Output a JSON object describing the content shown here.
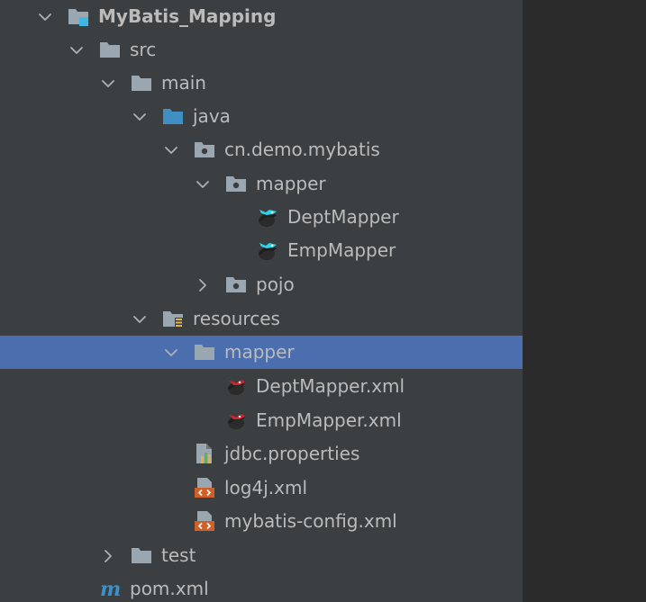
{
  "project_tree": {
    "project": {
      "label": "MyBatis_Mapping",
      "icon": "module-folder-icon",
      "expanded": true
    },
    "src": {
      "label": "src",
      "icon": "folder-icon",
      "expanded": true
    },
    "main": {
      "label": "main",
      "icon": "folder-icon",
      "expanded": true
    },
    "java": {
      "label": "java",
      "icon": "source-root-folder-icon",
      "expanded": true
    },
    "package": {
      "label": "cn.demo.mybatis",
      "icon": "package-icon",
      "expanded": true
    },
    "mapper_pkg": {
      "label": "mapper",
      "icon": "package-icon",
      "expanded": true
    },
    "dept_mapper": {
      "label": "DeptMapper",
      "icon": "mybatis-bird-icon"
    },
    "emp_mapper": {
      "label": "EmpMapper",
      "icon": "mybatis-bird-icon"
    },
    "pojo_pkg": {
      "label": "pojo",
      "icon": "package-icon",
      "expanded": false
    },
    "resources": {
      "label": "resources",
      "icon": "resources-root-folder-icon",
      "expanded": true
    },
    "mapper_dir": {
      "label": "mapper",
      "icon": "folder-icon",
      "expanded": true,
      "selected": true
    },
    "dept_mapper_xml": {
      "label": "DeptMapper.xml",
      "icon": "mybatis-xml-icon"
    },
    "emp_mapper_xml": {
      "label": "EmpMapper.xml",
      "icon": "mybatis-xml-icon"
    },
    "jdbc_props": {
      "label": "jdbc.properties",
      "icon": "properties-file-icon"
    },
    "log4j_xml": {
      "label": "log4j.xml",
      "icon": "xml-file-icon"
    },
    "mybatis_config": {
      "label": "mybatis-config.xml",
      "icon": "xml-file-icon"
    },
    "test": {
      "label": "test",
      "icon": "folder-icon",
      "expanded": false
    },
    "pom": {
      "label": "pom.xml",
      "icon": "maven-icon"
    }
  },
  "colors": {
    "panel_bg": "#3c3f41",
    "editor_bg": "#2b2b2b",
    "selection": "#4b6eaf",
    "text": "#bbbbbb",
    "folder_gray": "#9aa7b0",
    "source_folder": "#3f8fc2",
    "module_badge": "#40b6e0",
    "maven": "#3a8fcc",
    "xml_orange": "#d0602a"
  }
}
